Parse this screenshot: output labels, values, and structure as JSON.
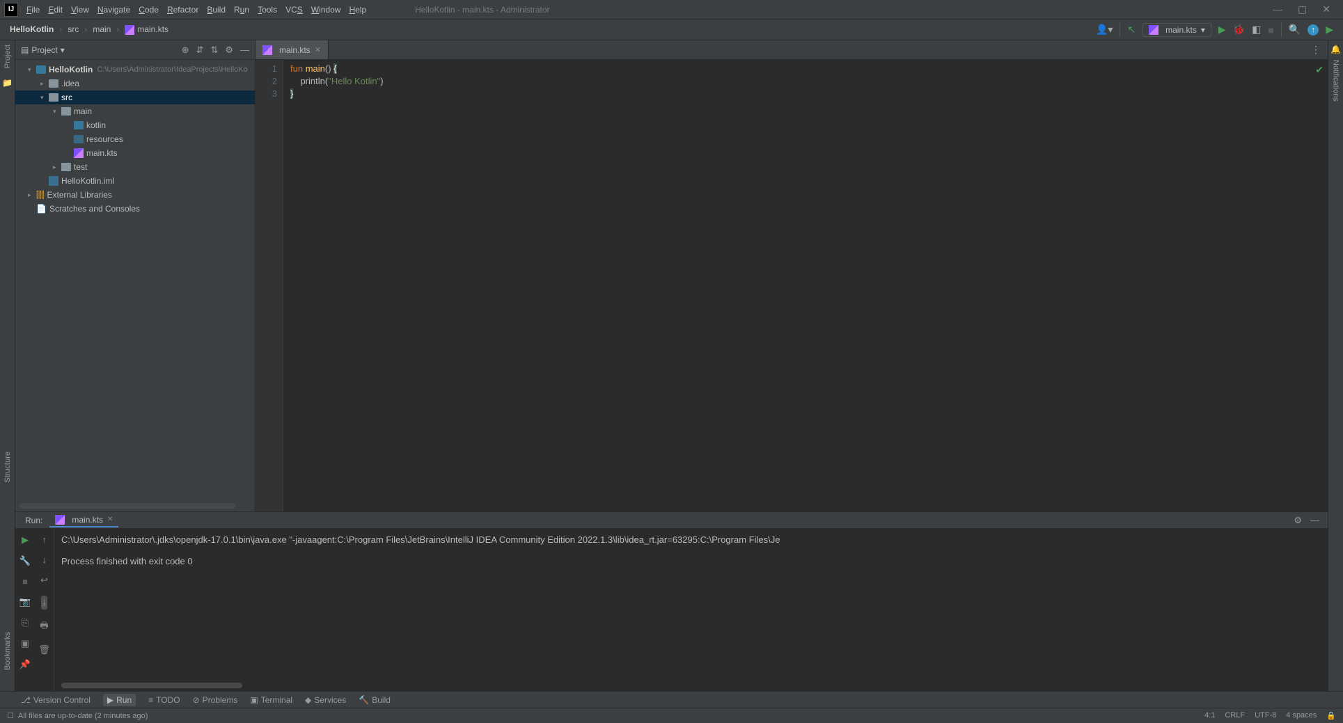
{
  "window": {
    "title": "HelloKotlin - main.kts - Administrator"
  },
  "menu": [
    "File",
    "Edit",
    "View",
    "Navigate",
    "Code",
    "Refactor",
    "Build",
    "Run",
    "Tools",
    "VCS",
    "Window",
    "Help"
  ],
  "breadcrumb": {
    "project": "HelloKotlin",
    "parts": [
      "src",
      "main",
      "main.kts"
    ]
  },
  "run_config": {
    "selected": "main.kts"
  },
  "project_view": {
    "title": "Project",
    "root": {
      "name": "HelloKotlin",
      "path": "C:\\Users\\Administrator\\IdeaProjects\\HelloKo"
    },
    "nodes": {
      "idea": ".idea",
      "src": "src",
      "main": "main",
      "kotlin": "kotlin",
      "resources": "resources",
      "mainkts": "main.kts",
      "test": "test",
      "iml": "HelloKotlin.iml",
      "ext": "External Libraries",
      "scratch": "Scratches and Consoles"
    }
  },
  "editor": {
    "tab": "main.kts",
    "lines": [
      "1",
      "2",
      "3"
    ],
    "code": {
      "l1_kw": "fun",
      "l1_fn": "main",
      "l1_rest": "() ",
      "l1_brace": "{",
      "l2_call": "println",
      "l2_str": "\"Hello Kotlin\"",
      "l2_close": ")",
      "l3_brace": "}"
    }
  },
  "run": {
    "label": "Run:",
    "tab": "main.kts",
    "output_line1": "C:\\Users\\Administrator\\.jdks\\openjdk-17.0.1\\bin\\java.exe \"-javaagent:C:\\Program Files\\JetBrains\\IntelliJ IDEA Community Edition 2022.1.3\\lib\\idea_rt.jar=63295:C:\\Program Files\\Je",
    "output_line3": "Process finished with exit code 0"
  },
  "bottom_tools": {
    "version_control": "Version Control",
    "run": "Run",
    "todo": "TODO",
    "problems": "Problems",
    "terminal": "Terminal",
    "services": "Services",
    "build": "Build"
  },
  "left_tools": {
    "project": "Project",
    "structure": "Structure",
    "bookmarks": "Bookmarks"
  },
  "right_tools": {
    "notifications": "Notifications"
  },
  "status": {
    "left": "All files are up-to-date (2 minutes ago)",
    "pos": "4:1",
    "line_sep": "CRLF",
    "encoding": "UTF-8",
    "indent": "4 spaces"
  }
}
